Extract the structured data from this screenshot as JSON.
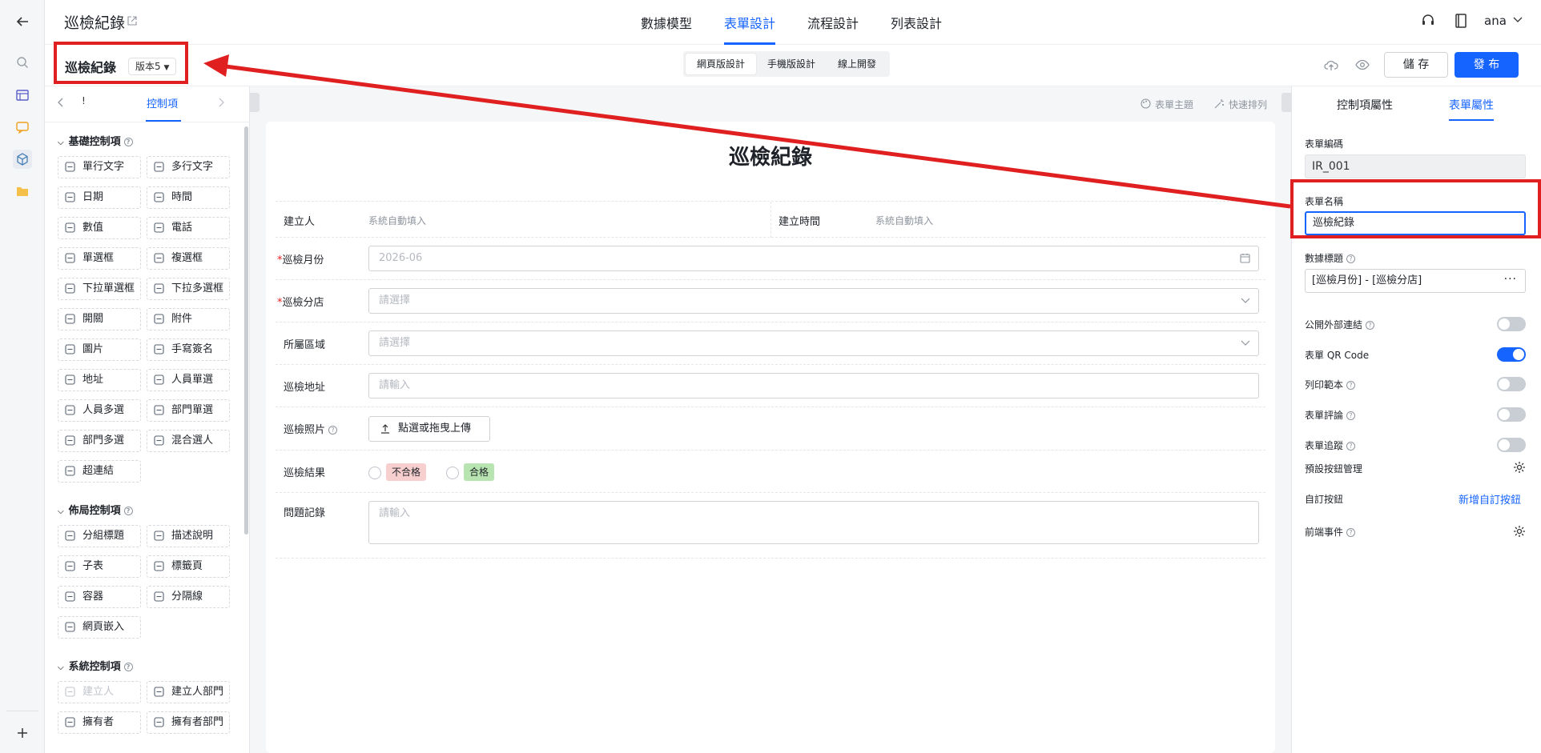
{
  "app": {
    "title": "巡檢紀錄",
    "user": "ana"
  },
  "nav_tabs": [
    {
      "label": "數據模型"
    },
    {
      "label": "表單設計",
      "active": true
    },
    {
      "label": "流程設計"
    },
    {
      "label": "列表設計"
    }
  ],
  "form_header": {
    "title": "巡檢紀錄",
    "version": "版本5"
  },
  "view_modes": [
    "網頁版設計",
    "手機版設計",
    "線上開發"
  ],
  "actions": {
    "save": "儲 存",
    "publish": "發 布"
  },
  "palette": {
    "tab_label": "控制項",
    "tab_prev_glyph": "!",
    "sections": [
      {
        "title": "基礎控制項",
        "items": [
          {
            "label": "單行文字",
            "icon": "single-line-text-icon"
          },
          {
            "label": "多行文字",
            "icon": "multi-line-text-icon"
          },
          {
            "label": "日期",
            "icon": "calendar-icon"
          },
          {
            "label": "時間",
            "icon": "clock-icon"
          },
          {
            "label": "數值",
            "icon": "number-icon"
          },
          {
            "label": "電話",
            "icon": "phone-icon"
          },
          {
            "label": "單選框",
            "icon": "radio-icon"
          },
          {
            "label": "複選框",
            "icon": "checkbox-icon"
          },
          {
            "label": "下拉單選框",
            "icon": "dropdown-list-icon"
          },
          {
            "label": "下拉多選框",
            "icon": "dropdown-multi-icon"
          },
          {
            "label": "開關",
            "icon": "switch-icon"
          },
          {
            "label": "附件",
            "icon": "paperclip-icon"
          },
          {
            "label": "圖片",
            "icon": "image-icon"
          },
          {
            "label": "手寫簽名",
            "icon": "pen-icon"
          },
          {
            "label": "地址",
            "icon": "location-pin-icon"
          },
          {
            "label": "人員單選",
            "icon": "user-icon"
          },
          {
            "label": "人員多選",
            "icon": "users-icon"
          },
          {
            "label": "部門單選",
            "icon": "department-icon"
          },
          {
            "label": "部門多選",
            "icon": "department-multi-icon"
          },
          {
            "label": "混合選人",
            "icon": "user-mixed-icon"
          },
          {
            "label": "超連結",
            "icon": "link-icon"
          }
        ]
      },
      {
        "title": "佈局控制項",
        "items": [
          {
            "label": "分組標題",
            "icon": "heading-icon"
          },
          {
            "label": "描述說明",
            "icon": "help-circle-icon"
          },
          {
            "label": "子表",
            "icon": "table-icon"
          },
          {
            "label": "標籤頁",
            "icon": "tabs-icon"
          },
          {
            "label": "容器",
            "icon": "cube-icon"
          },
          {
            "label": "分隔線",
            "icon": "divider-icon"
          },
          {
            "label": "網頁嵌入",
            "icon": "web-embed-icon"
          }
        ]
      },
      {
        "title": "系統控制項",
        "items": [
          {
            "label": "建立人",
            "icon": "user-icon",
            "disabled": true
          },
          {
            "label": "建立人部門",
            "icon": "department-icon"
          },
          {
            "label": "擁有者",
            "icon": "user-icon"
          },
          {
            "label": "擁有者部門",
            "icon": "department-icon"
          }
        ]
      }
    ]
  },
  "canvas_toolbar": {
    "theme": "表單主題",
    "quick_layout": "快速排列"
  },
  "form": {
    "title": "巡檢紀錄",
    "creator_label": "建立人",
    "creator_value": "系統自動填入",
    "created_at_label": "建立時間",
    "created_at_value": "系統自動填入",
    "fields": [
      {
        "label": "巡檢月份",
        "required": true,
        "placeholder": "2026-06",
        "type": "date"
      },
      {
        "label": "巡檢分店",
        "required": true,
        "placeholder": "請選擇",
        "type": "select"
      },
      {
        "label": "所屬區域",
        "required": false,
        "placeholder": "請選擇",
        "type": "select"
      },
      {
        "label": "巡檢地址",
        "required": false,
        "placeholder": "請輸入",
        "type": "text"
      },
      {
        "label": "巡檢照片",
        "required": false,
        "placeholder": "點選或拖曳上傳",
        "type": "upload"
      },
      {
        "label": "巡檢結果",
        "required": false,
        "type": "radio",
        "options": [
          {
            "label": "不合格",
            "color": "#f8cfcf"
          },
          {
            "label": "合格",
            "color": "#b7e4b0"
          }
        ]
      },
      {
        "label": "問題記錄",
        "required": false,
        "placeholder": "請輸入",
        "type": "textarea"
      }
    ]
  },
  "props": {
    "tabs": [
      {
        "label": "控制項屬性"
      },
      {
        "label": "表單屬性",
        "active": true
      }
    ],
    "code_label": "表單編碼",
    "code_value": "IR_001",
    "name_label": "表單名稱",
    "name_value": "巡檢紀錄",
    "data_title_label": "數據標題",
    "data_title_value": "[巡檢月份] - [巡檢分店]",
    "toggles": [
      {
        "label": "公開外部連結",
        "on": false
      },
      {
        "label": "表單 QR Code",
        "on": true
      },
      {
        "label": "列印範本",
        "on": false
      },
      {
        "label": "表單評論",
        "on": false
      },
      {
        "label": "表單追蹤",
        "on": false
      }
    ],
    "default_buttons_label": "預設按鈕管理",
    "custom_buttons_label": "自訂按鈕",
    "custom_buttons_action": "新增自訂按鈕",
    "frontend_events_label": "前端事件"
  },
  "colors": {
    "accent": "#1664ff",
    "annotation": "#e02020"
  }
}
